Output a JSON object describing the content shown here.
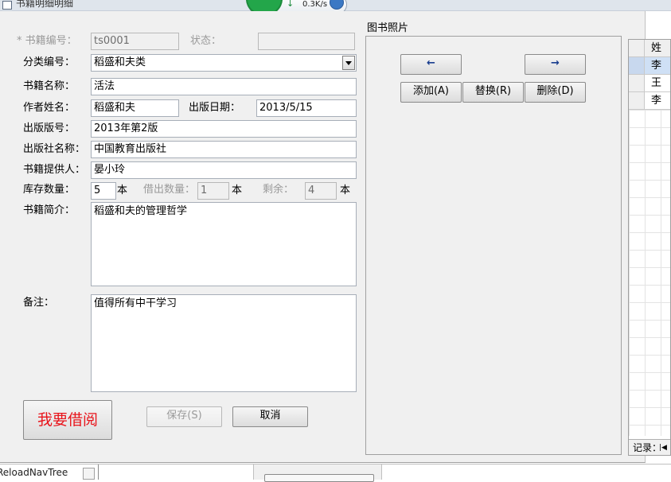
{
  "window": {
    "title": "书籍明细明细"
  },
  "network": {
    "speed": "0.3K/s",
    "arrow": "↓"
  },
  "form": {
    "book_no": {
      "label": "* 书籍编号：",
      "value": "ts0001"
    },
    "status": {
      "label": "状态：",
      "value": ""
    },
    "category": {
      "label": "分类编号：",
      "value": "稻盛和夫类"
    },
    "book_name": {
      "label": "书籍名称：",
      "value": "活法"
    },
    "author": {
      "label": "作者姓名：",
      "value": "稻盛和夫"
    },
    "pub_date": {
      "label": "出版日期：",
      "value": "2013/5/15"
    },
    "edition": {
      "label": "出版版号：",
      "value": "2013年第2版"
    },
    "publisher": {
      "label": "出版社名称：",
      "value": "中国教育出版社"
    },
    "provider": {
      "label": "书籍提供人：",
      "value": "晏小玲"
    },
    "stock": {
      "label": "库存数量：",
      "value": "5",
      "unit": "本"
    },
    "lent": {
      "label": "借出数量：",
      "value": "1",
      "unit": "本"
    },
    "remaining": {
      "label": "剩余：",
      "value": "4",
      "unit": "本"
    },
    "summary": {
      "label": "书籍简介：",
      "value": "稻盛和夫的管理哲学"
    },
    "notes": {
      "label": "备注：",
      "value": "值得所有中干学习"
    }
  },
  "buttons": {
    "borrow": "我要借阅",
    "save": "保存(S)",
    "cancel": "取消"
  },
  "photo": {
    "title": "图书照片",
    "prev": "←",
    "next": "→",
    "add": "添加(A)",
    "replace": "替换(R)",
    "delete": "删除(D)"
  },
  "grid": {
    "header": "姓",
    "rows": [
      "李",
      "王",
      "李"
    ],
    "records_label": "记录：",
    "nav_first": "|◀"
  },
  "background": {
    "bottom_text": "ReloadNavTree"
  },
  "colors": {
    "borrow_text": "#e8141b",
    "accent": "#1a56b0",
    "badge_green": "#23a64a"
  }
}
